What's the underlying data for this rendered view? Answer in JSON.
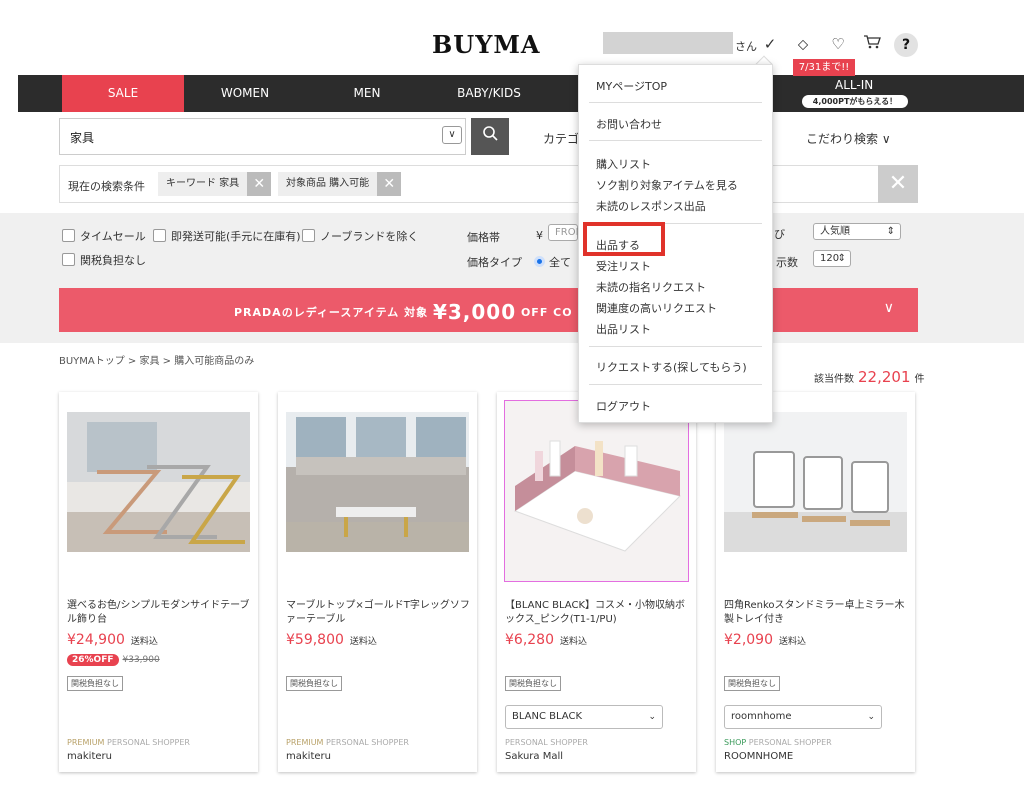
{
  "header": {
    "logo": "BUYMA",
    "user_suffix": "さん",
    "icons": [
      "check-icon",
      "tag-icon",
      "heart-icon",
      "cart-icon",
      "help-icon"
    ],
    "help_label": "?"
  },
  "nav": {
    "items": [
      "SALE",
      "WOMEN",
      "MEN",
      "BABY/KIDS"
    ],
    "allin_badge": "7/31まで!!",
    "allin_label": "ALL-IN",
    "allin_pill": "4,000PTがもらえる！"
  },
  "search": {
    "value": "家具",
    "category_label": "カテゴ",
    "kodawari_label": "こだわり検索 ∨"
  },
  "conditions": {
    "label": "現在の検索条件",
    "tags": [
      "キーワード 家具",
      "対象商品 購入可能"
    ]
  },
  "filters": {
    "checkboxes": [
      "タイムセール",
      "即発送可能(手元に在庫有)",
      "ノーブランドを除く",
      "関税負担なし"
    ],
    "price_label": "価格帯",
    "price_yen": "¥",
    "price_from": "FROM",
    "price_type_label": "価格タイプ",
    "price_type_value": "全て",
    "sort_label_partial": "び",
    "sort_value": "人気順",
    "display_label_partial": "示数",
    "display_value": "120"
  },
  "promo": {
    "text_before": "PRADAのレディースアイテム 対象 ",
    "amount": "¥3,000",
    "text_after": " OFF CO"
  },
  "breadcrumb": "BUYMAトップ > 家具 > 購入可能商品のみ",
  "result": {
    "label": "該当件数",
    "count": "22,201",
    "unit": "件"
  },
  "products": [
    {
      "title": "選べるお色/シンプルモダンサイドテーブル飾り台",
      "price": "¥24,900",
      "shipping": "送料込",
      "discount": "26%OFF",
      "old_price": "¥33,900",
      "duty": "関税負担なし",
      "shopper_rank": "PREMIUM",
      "shopper_type": "PERSONAL SHOPPER",
      "shopper": "makiteru"
    },
    {
      "title": "マーブルトップ×ゴールドT字レッグソファーテーブル",
      "price": "¥59,800",
      "shipping": "送料込",
      "duty": "関税負担なし",
      "shopper_rank": "PREMIUM",
      "shopper_type": "PERSONAL SHOPPER",
      "shopper": "makiteru"
    },
    {
      "title": "【BLANC BLACK】コスメ・小物収納ボックス_ピンク(T1-1/PU)",
      "price": "¥6,280",
      "shipping": "送料込",
      "duty": "関税負担なし",
      "brand": "BLANC BLACK",
      "shopper_type": "PERSONAL SHOPPER",
      "shopper": "Sakura Mall"
    },
    {
      "title": "四角Renkoスタンドミラー卓上ミラー木製トレイ付き",
      "price": "¥2,090",
      "shipping": "送料込",
      "duty": "関税負担なし",
      "brand": "roomnhome",
      "shopper_rank": "SHOP",
      "shopper_type": "PERSONAL SHOPPER",
      "shopper": "ROOMNHOME"
    }
  ],
  "menu": {
    "items": [
      "MYページTOP",
      "お問い合わせ",
      "購入リスト",
      "ソク割り対象アイテムを見る",
      "未読のレスポンス出品",
      "出品する",
      "受注リスト",
      "未読の指名リクエスト",
      "関連度の高いリクエスト",
      "出品リスト",
      "リクエストする(探してもらう)",
      "ログアウト"
    ],
    "highlight_color": "#e0322a"
  },
  "colors": {
    "accent": "#e8424f",
    "nav_bg": "#2c2c2c",
    "promo_bg": "#ec5a6a"
  }
}
